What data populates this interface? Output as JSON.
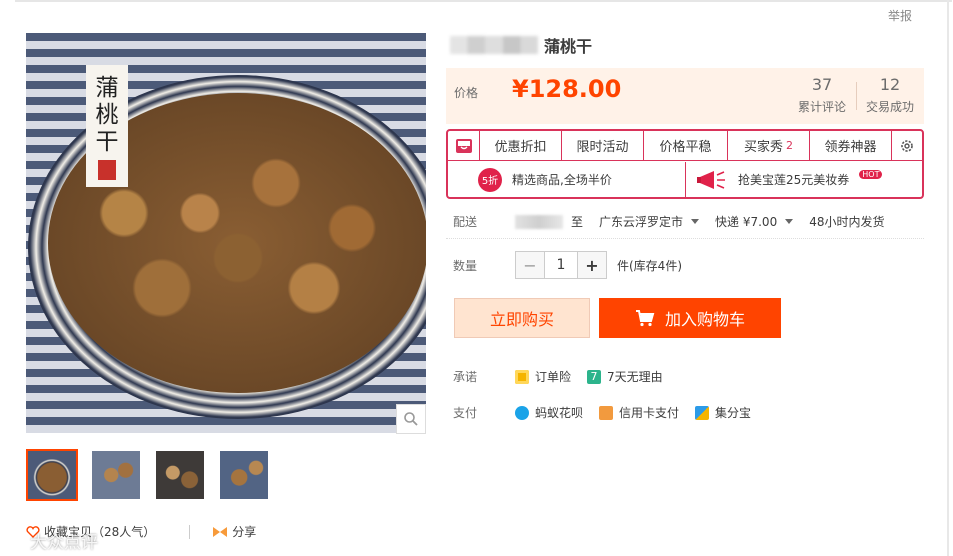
{
  "report": "举报",
  "gallery": {
    "label_chars": "蒲桃干",
    "thumb_count": 4
  },
  "social": {
    "favorite": "收藏宝贝（28人气）",
    "share": "分享"
  },
  "watermark": "大众点评",
  "product": {
    "title": "蒲桃干"
  },
  "price": {
    "label": "价格",
    "value": "¥128.00",
    "reviews_count": "37",
    "reviews_label": "累计评论",
    "deals_count": "12",
    "deals_label": "交易成功"
  },
  "promo": {
    "tabs": [
      {
        "label": "优惠折扣"
      },
      {
        "label": "限时活动"
      },
      {
        "label": "价格平稳"
      },
      {
        "label": "买家秀",
        "badge": "2"
      },
      {
        "label": "领券神器"
      }
    ],
    "left_text": "精选商品,全场半价",
    "left_badge": "5折",
    "right_text": "抢美宝莲25元美妆券",
    "right_hot": "HOT"
  },
  "shipping": {
    "label": "配送",
    "to": "至",
    "destination": "广东云浮罗定市",
    "method": "快递 ¥7.00",
    "dispatch": "48小时内发货"
  },
  "quantity": {
    "label": "数量",
    "minus": "−",
    "value": "1",
    "plus": "+",
    "stock": "件(库存4件)"
  },
  "actions": {
    "buy_now": "立即购买",
    "add_cart": "加入购物车"
  },
  "promise": {
    "label": "承诺",
    "items": [
      "订单险",
      "7天无理由"
    ]
  },
  "payment": {
    "label": "支付",
    "items": [
      "蚂蚁花呗",
      "信用卡支付",
      "集分宝"
    ]
  },
  "colors": {
    "accent": "#ff4400",
    "promo_border": "#d9335a",
    "price_bg": "#fff2e8"
  }
}
